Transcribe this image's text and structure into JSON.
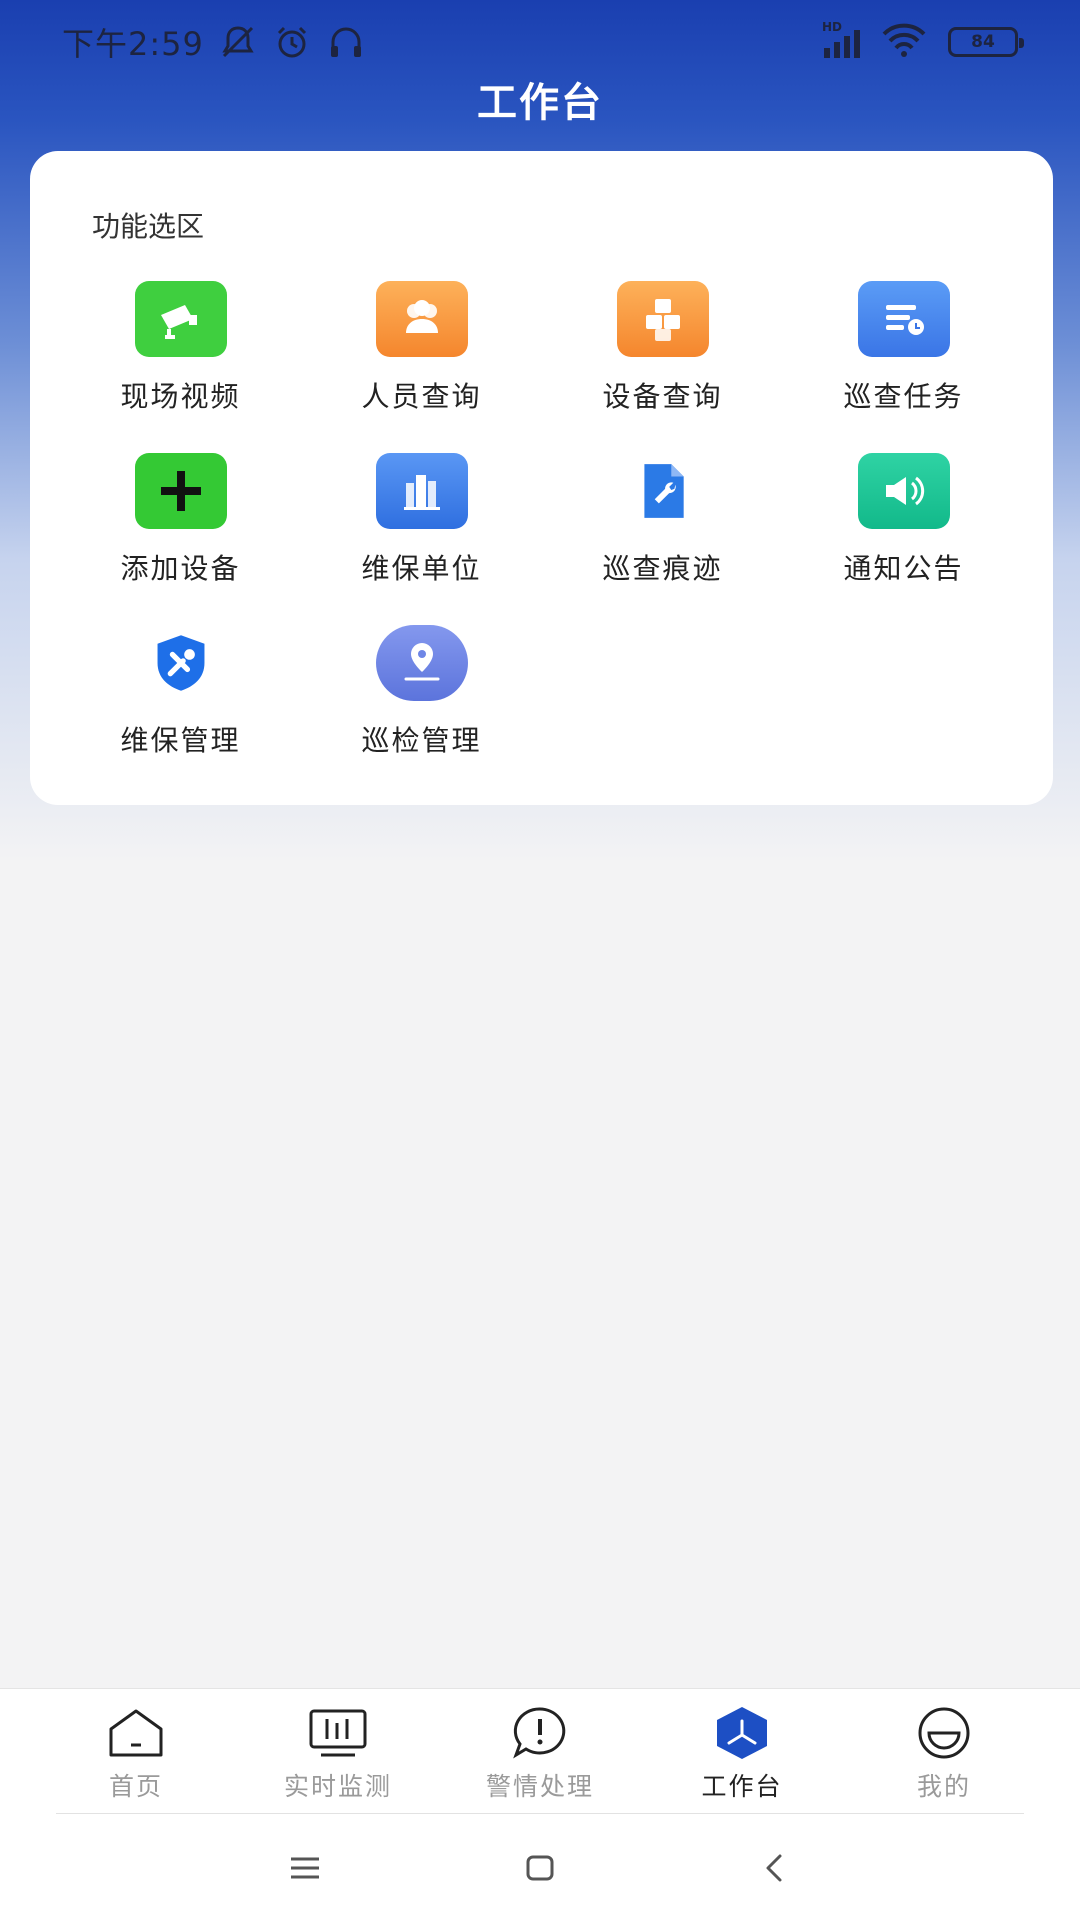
{
  "status_bar": {
    "time": "下午2:59",
    "battery": "84",
    "network": "HD"
  },
  "header": {
    "title": "工作台"
  },
  "card": {
    "section_title": "功能选区",
    "items": [
      {
        "label": "现场视频",
        "icon": "camera-icon",
        "color": "#3fcf3f"
      },
      {
        "label": "人员查询",
        "icon": "people-icon",
        "color": "#f89b3b"
      },
      {
        "label": "设备查询",
        "icon": "boxes-icon",
        "color": "#f89b3b"
      },
      {
        "label": "巡查任务",
        "icon": "task-icon",
        "color": "#4a8af0"
      },
      {
        "label": "添加设备",
        "icon": "plus-icon",
        "color": "#34c934"
      },
      {
        "label": "维保单位",
        "icon": "building-icon",
        "color": "#3d7fe8"
      },
      {
        "label": "巡查痕迹",
        "icon": "wrench-doc-icon",
        "color": "#2b7ae6"
      },
      {
        "label": "通知公告",
        "icon": "speaker-icon",
        "color": "#1fc296"
      },
      {
        "label": "维保管理",
        "icon": "shield-tools-icon",
        "color": "#1e6fe8"
      },
      {
        "label": "巡检管理",
        "icon": "location-icon",
        "color": "#6e86e6"
      }
    ]
  },
  "tabs": [
    {
      "label": "首页",
      "icon": "home-icon",
      "active": false
    },
    {
      "label": "实时监测",
      "icon": "monitor-icon",
      "active": false
    },
    {
      "label": "警情处理",
      "icon": "alert-icon",
      "active": false
    },
    {
      "label": "工作台",
      "icon": "workbench-icon",
      "active": true
    },
    {
      "label": "我的",
      "icon": "profile-icon",
      "active": false
    }
  ],
  "colors": {
    "header_blue": "#1a3fb0",
    "active_tab": "#1d4fc4",
    "inactive_tab": "#9a9a9a"
  }
}
